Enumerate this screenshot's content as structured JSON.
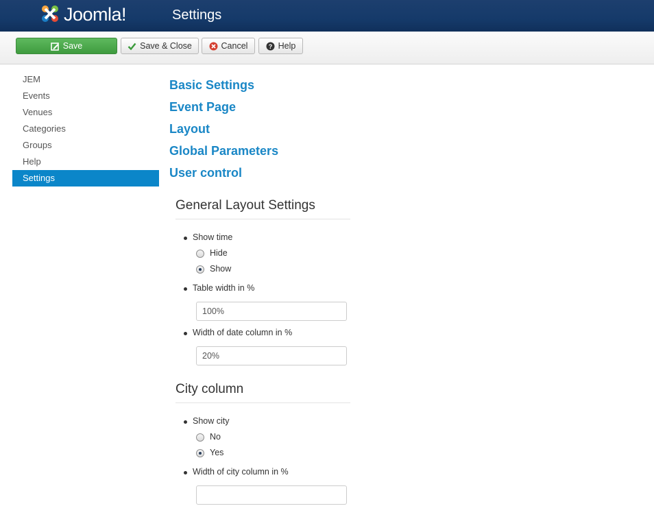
{
  "header": {
    "logo_text": "Joomla!",
    "page_title": "Settings"
  },
  "toolbar": {
    "save_label": "Save",
    "save_close_label": "Save & Close",
    "cancel_label": "Cancel",
    "help_label": "Help"
  },
  "sidebar": {
    "items": [
      {
        "label": "JEM",
        "active": false
      },
      {
        "label": "Events",
        "active": false
      },
      {
        "label": "Venues",
        "active": false
      },
      {
        "label": "Categories",
        "active": false
      },
      {
        "label": "Groups",
        "active": false
      },
      {
        "label": "Help",
        "active": false
      },
      {
        "label": "Settings",
        "active": true
      }
    ]
  },
  "sections": [
    "Basic Settings",
    "Event Page",
    "Layout",
    "Global Parameters",
    "User control"
  ],
  "general_layout": {
    "legend": "General Layout Settings",
    "show_time": {
      "label": "Show time",
      "options": [
        "Hide",
        "Show"
      ],
      "selected": "Show"
    },
    "table_width": {
      "label": "Table width in %",
      "value": "100%"
    },
    "date_column_width": {
      "label": "Width of date column in %",
      "value": "20%"
    }
  },
  "city_column": {
    "legend": "City column",
    "show_city": {
      "label": "Show city",
      "options": [
        "No",
        "Yes"
      ],
      "selected": "Yes"
    },
    "city_column_width": {
      "label": "Width of city column in %",
      "value": ""
    }
  },
  "colors": {
    "header": "#153a6a",
    "accent": "#0b86c9",
    "link": "#1a87c6",
    "save_button": "#4cab4c"
  }
}
